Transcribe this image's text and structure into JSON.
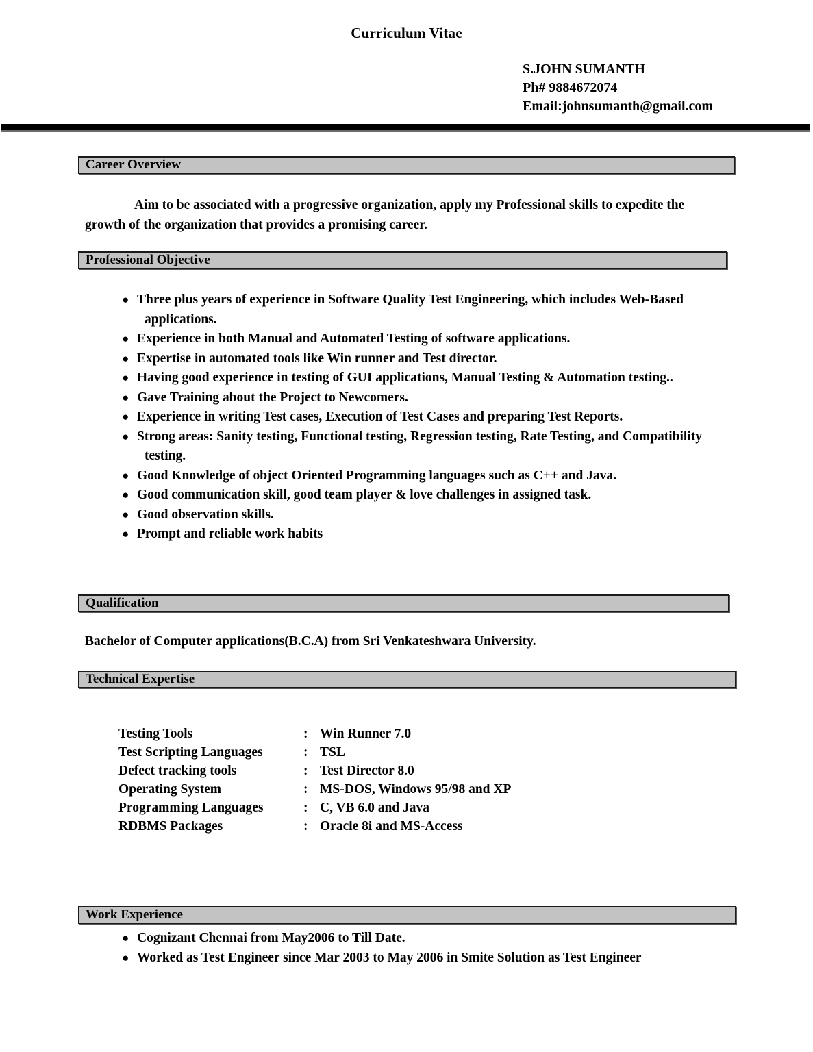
{
  "document": {
    "title": "Curriculum Vitae"
  },
  "contact": {
    "name": "S.JOHN SUMANTH",
    "phone": "Ph# 9884672074",
    "email": "Email:johnsumanth@gmail.com"
  },
  "colors": {
    "section_bar_fill": "#c3c3c3",
    "section_bar_border": "#1a1a1a",
    "rule": "#000000",
    "text": "#000000"
  },
  "sections": {
    "career_overview": {
      "heading": "Career Overview",
      "paragraph_first": "Aim to be associated with a progressive organization, apply my Professional skills to",
      "paragraph_rest": "expedite the growth of the organization that provides a promising career."
    },
    "professional_objective": {
      "heading": "Professional Objective",
      "bullets": [
        "Three plus years of experience in Software Quality Test Engineering, which includes Web-Based applications.",
        "Experience in both Manual and Automated Testing of software applications.",
        "Expertise in automated tools like Win runner and Test director.",
        "Having good experience in testing of GUI applications, Manual Testing & Automation testing..",
        "Gave Training about the Project to Newcomers.",
        "Experience in writing Test cases, Execution of Test Cases and preparing Test Reports.",
        "Strong areas: Sanity testing, Functional testing, Regression testing, Rate Testing, and Compatibility testing.",
        "Good Knowledge of object Oriented Programming languages such as C++ and Java.",
        "Good communication skill, good team player & love challenges in assigned task.",
        "Good observation skills.",
        "Prompt and reliable work habits"
      ]
    },
    "qualification": {
      "heading": "Qualification",
      "text": "Bachelor of Computer applications(B.C.A)  from Sri Venkateshwara University."
    },
    "technical_expertise": {
      "heading": "Technical Expertise",
      "separator": ":",
      "rows": [
        {
          "label": "Testing Tools",
          "value": "Win Runner 7.0"
        },
        {
          "label": "Test Scripting Languages",
          "value": "TSL"
        },
        {
          "label": "Defect tracking tools",
          "value": "Test Director 8.0"
        },
        {
          "label": "Operating System",
          "value": "MS-DOS, Windows 95/98 and XP"
        },
        {
          "label": "Programming Languages",
          "value": "C, VB 6.0 and Java"
        },
        {
          "label": "RDBMS Packages",
          "value": "Oracle 8i and MS-Access"
        }
      ]
    },
    "work_experience": {
      "heading": "Work Experience",
      "bullets": [
        "Cognizant Chennai from May2006 to Till Date.",
        "Worked as Test Engineer since Mar 2003 to May 2006 in Smite Solution as Test Engineer"
      ]
    }
  }
}
